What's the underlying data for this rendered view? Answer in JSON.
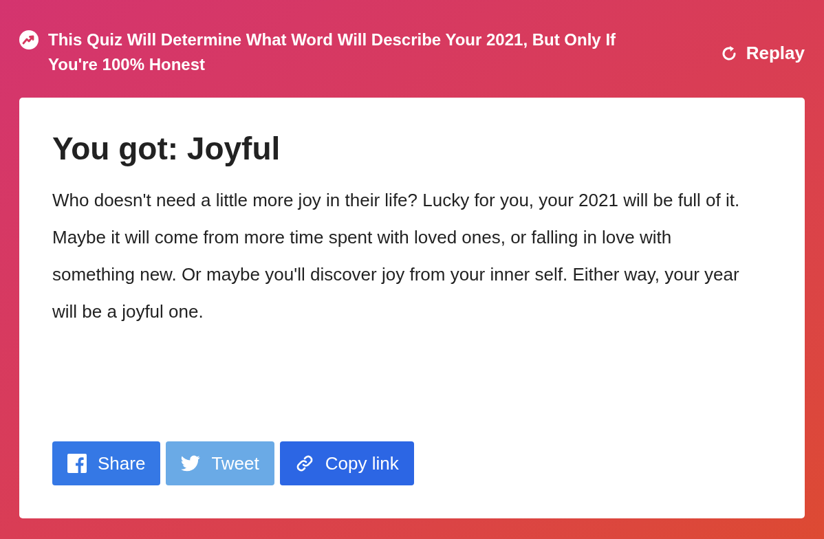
{
  "header": {
    "title": "This Quiz Will Determine What Word Will Describe Your 2021, But Only If You're 100% Honest",
    "replay_label": "Replay"
  },
  "result": {
    "heading": "You got: Joyful",
    "description": "Who doesn't need a little more joy in their life? Lucky for you, your 2021 will be full of it. Maybe it will come from more time spent with loved ones, or falling in love with something new. Or maybe you'll discover joy from your inner self. Either way, your year will be a joyful one."
  },
  "share_buttons": [
    {
      "kind": "facebook",
      "label": "Share"
    },
    {
      "kind": "twitter",
      "label": "Tweet"
    },
    {
      "kind": "link",
      "label": "Copy link"
    }
  ]
}
